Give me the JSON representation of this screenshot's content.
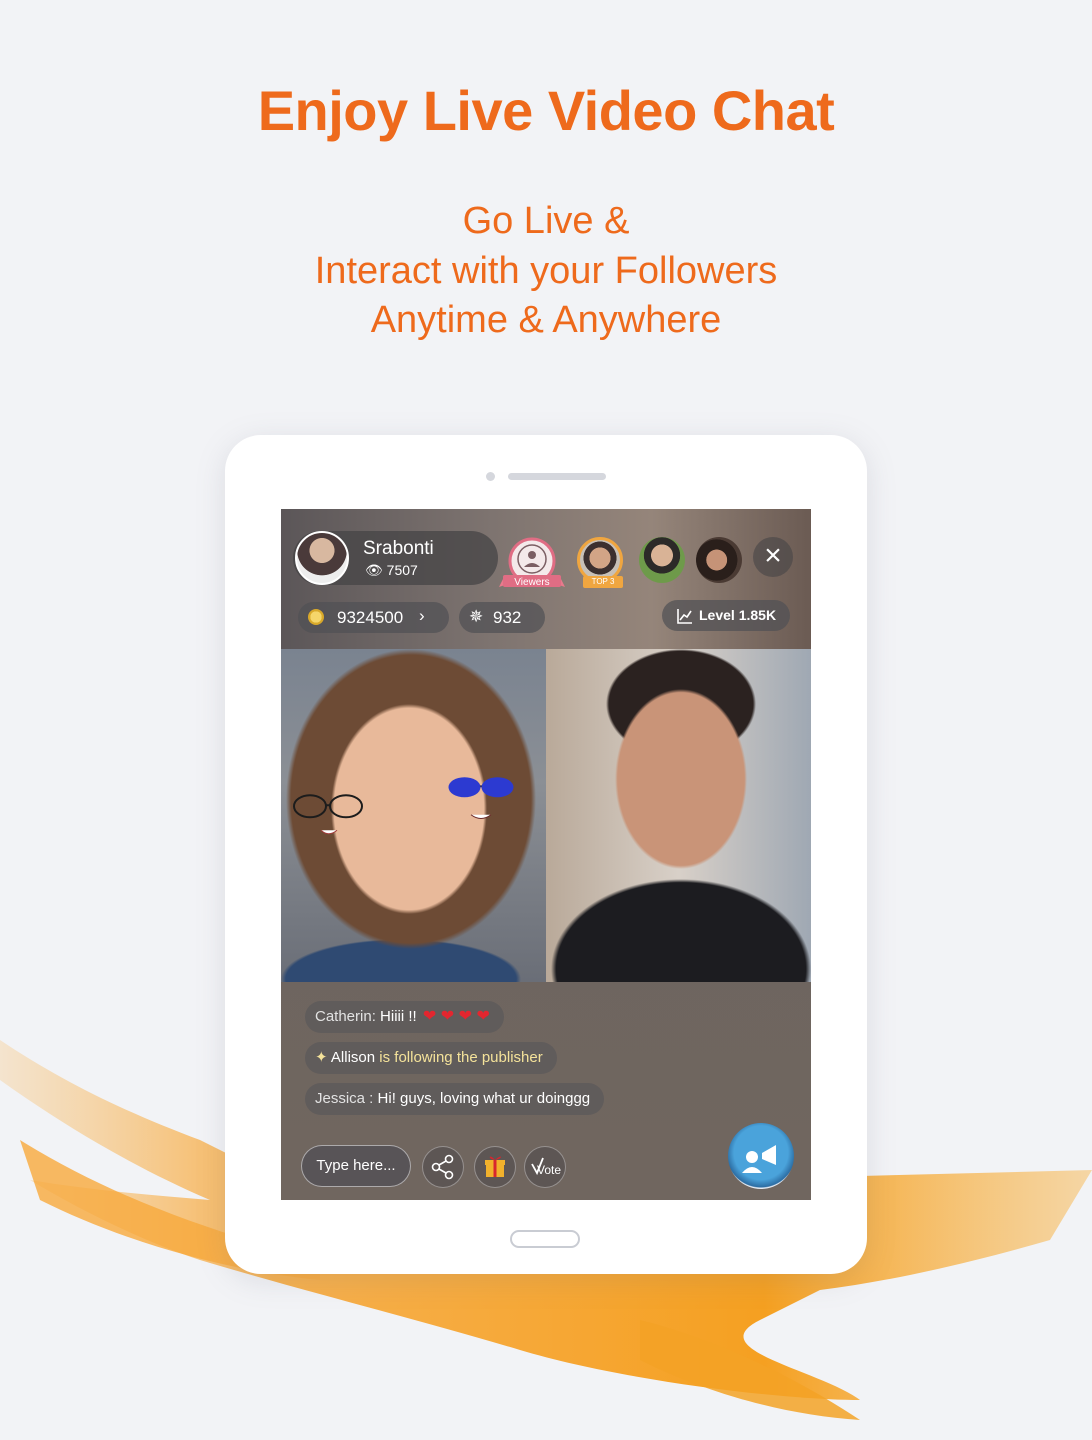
{
  "headline": "Enjoy Live Video Chat",
  "subline": [
    "Go Live &",
    "Interact with your Followers",
    "Anytime & Anywhere"
  ],
  "live": {
    "host_name": "Srabonti",
    "host_viewers": "7507",
    "viewers_badge": "Viewers",
    "top_label": "TOP 3",
    "coins": "9324500",
    "gems": "932",
    "level": "Level 1.85K"
  },
  "chat": [
    {
      "user": "Catherin:",
      "text": "Hiiii !!",
      "hearts": 4
    },
    {
      "user": "Allison",
      "text": "is following the publisher"
    },
    {
      "user": "Jessica :",
      "text": "Hi! guys, loving what ur doinggg"
    }
  ],
  "input": {
    "placeholder": "Type here..."
  },
  "vote_label": "Vote",
  "colors": {
    "accent": "#ee6a1c",
    "background": "#f2f3f6",
    "brush": "#f5a623"
  },
  "icons": [
    "eye-icon",
    "coin-icon",
    "star-icon",
    "chart-icon",
    "close-icon",
    "share-icon",
    "gift-icon",
    "vote-icon",
    "megaphone-icon",
    "sparkle-icon",
    "heart-icon"
  ]
}
